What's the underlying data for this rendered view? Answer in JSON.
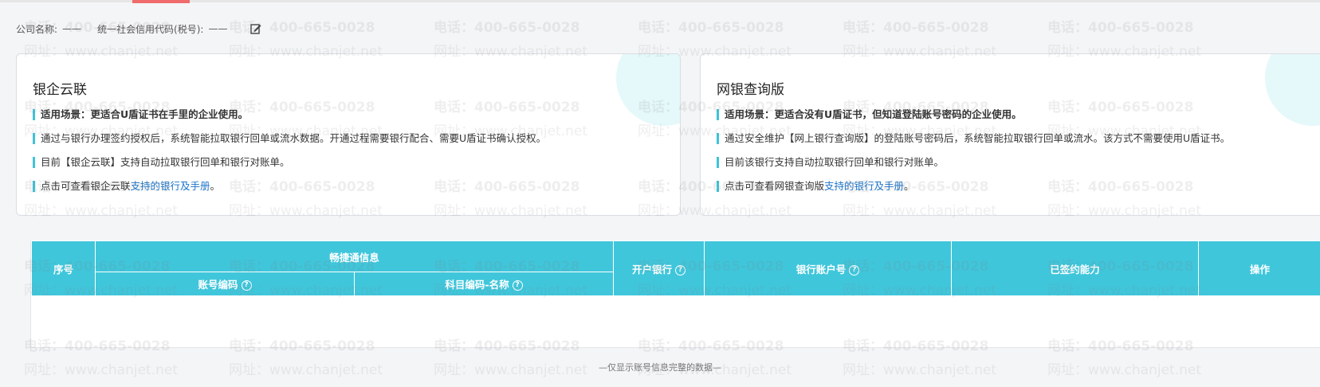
{
  "company": {
    "name_label": "公司名称:",
    "name_value": "——",
    "credit_label": "统一社会信用代码(税号):",
    "credit_value": "——"
  },
  "cards": [
    {
      "title": "银企云联",
      "items": [
        {
          "text": "适用场景：更适合U盾证书在手里的企业使用。"
        },
        {
          "text": "通过与银行办理签约授权后，系统智能拉取银行回单或流水数据。开通过程需要银行配合、需要U盾证书确认授权。"
        },
        {
          "text": "目前【银企云联】支持自动拉取银行回单和银行对账单。"
        },
        {
          "text": "点击可查看银企云联",
          "link": "支持的银行及手册",
          "suffix": "。"
        }
      ]
    },
    {
      "title": "网银查询版",
      "items": [
        {
          "text": "适用场景：更适合没有U盾证书，但知道登陆账号密码的企业使用。"
        },
        {
          "text": "通过安全维护【网上银行查询版】的登陆账号密码后，系统智能拉取银行回单或流水。该方式不需要使用U盾证书。"
        },
        {
          "text": "目前该银行支持自动拉取银行回单和银行对账单。"
        },
        {
          "text": "点击可查看网银查询版",
          "link": "支持的银行及手册",
          "suffix": "。"
        }
      ]
    }
  ],
  "table": {
    "col_index": "序号",
    "group": "畅捷通信息",
    "col_account_code": "账号编码",
    "col_subject": "科目编码-名称",
    "col_bank": "开户银行",
    "col_bank_account": "银行账户号",
    "col_signed": "已签约能力",
    "col_action": "操作",
    "help_glyph": "?"
  },
  "empty_note": "—仅显示账号信息完整的数据—",
  "watermark": {
    "phone": "电话：400-665-0028",
    "url": "网址：www.chanjet.net"
  }
}
